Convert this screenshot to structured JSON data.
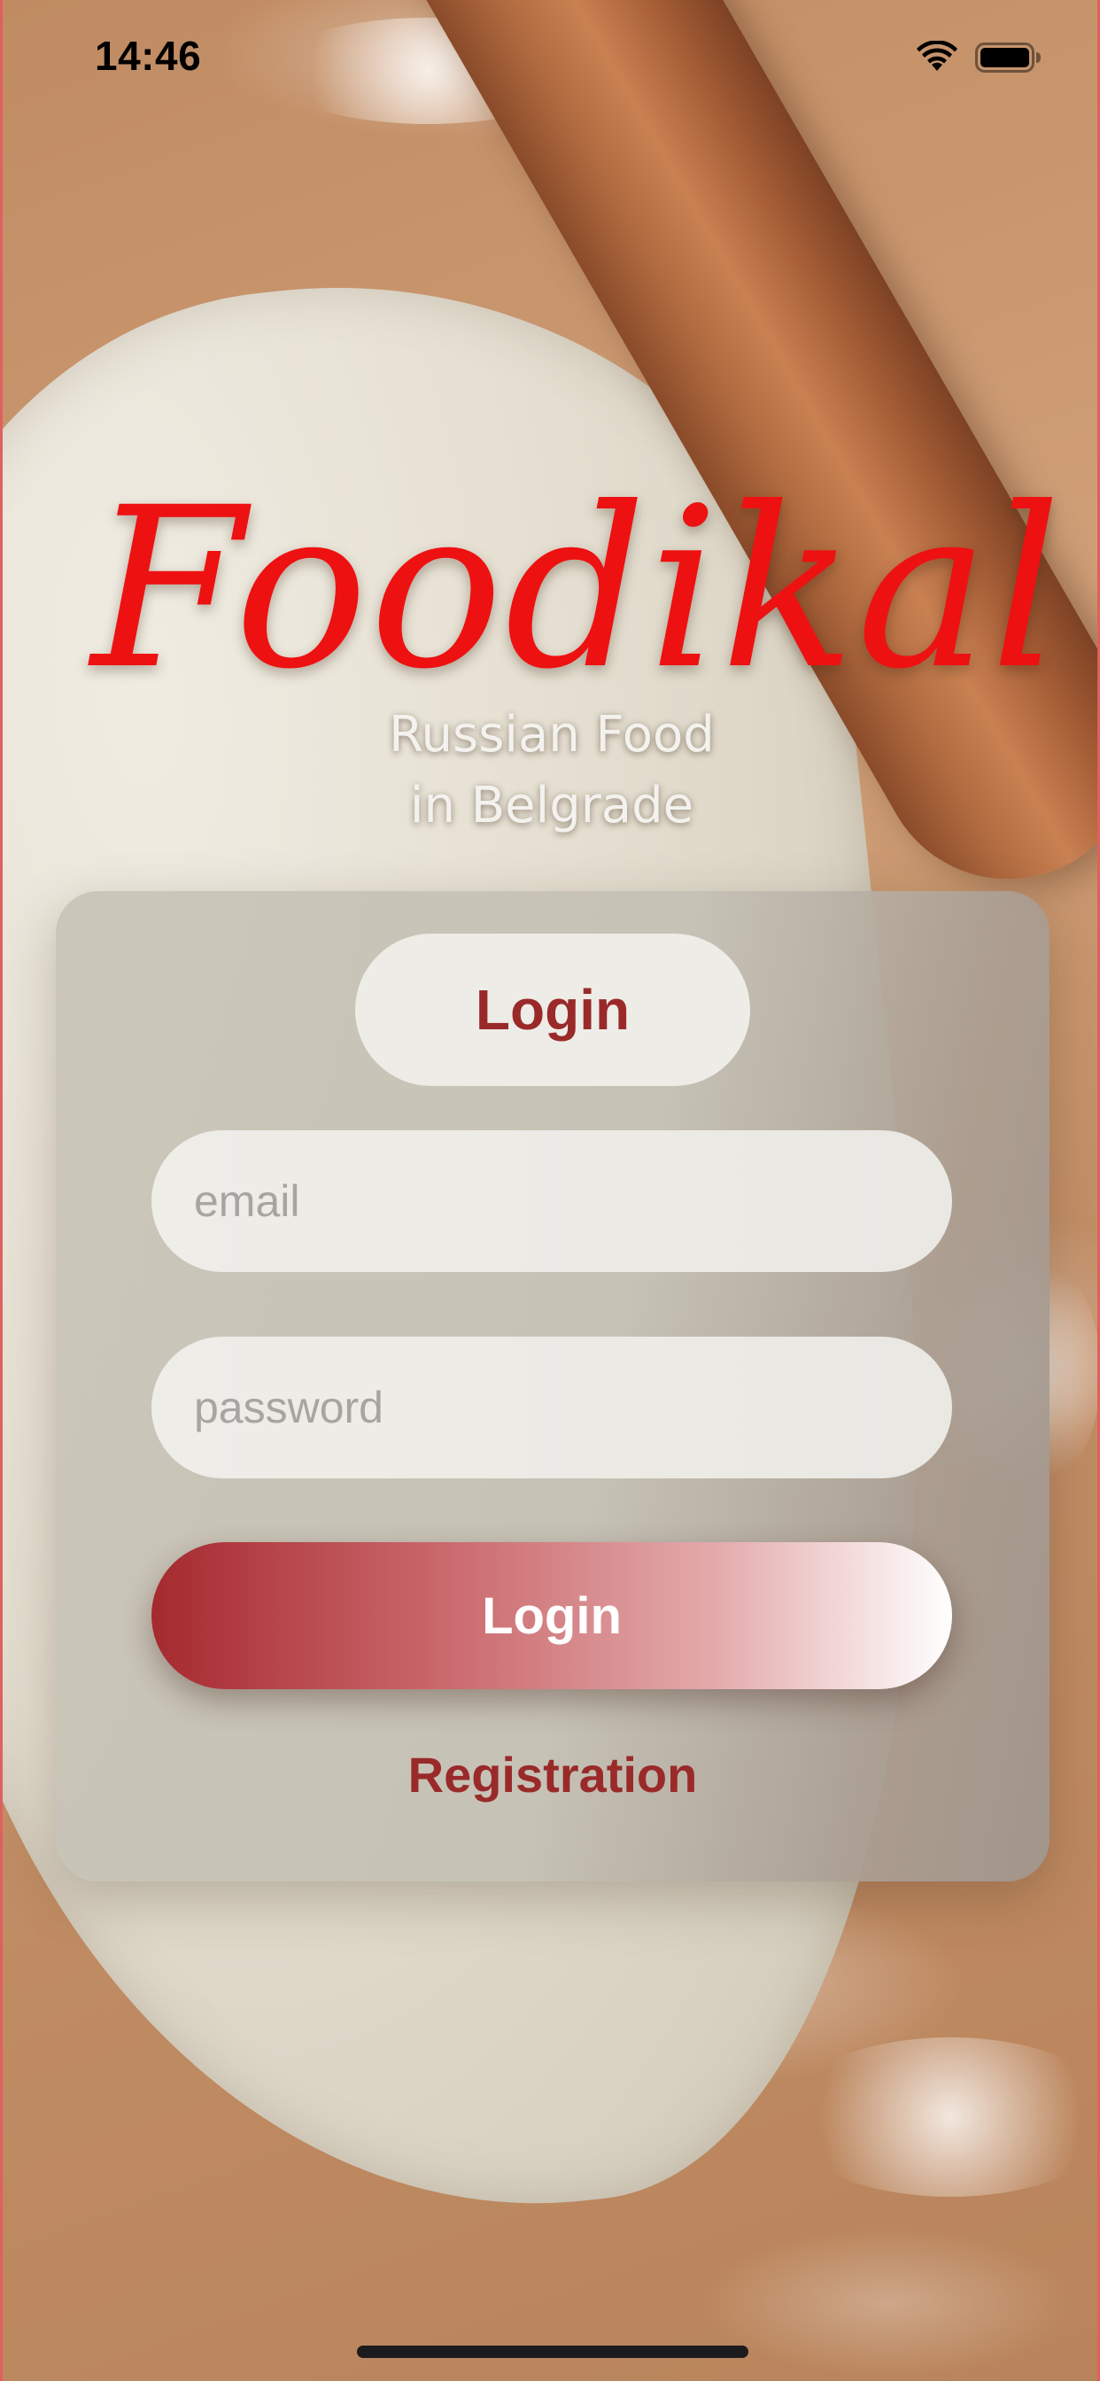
{
  "status_bar": {
    "time": "14:46"
  },
  "logo": {
    "title": "Foodikal",
    "subtitle_line1": "Russian Food",
    "subtitle_line2": "in Belgrade"
  },
  "card": {
    "tab_label": "Login",
    "email_placeholder": "email",
    "password_placeholder": "password",
    "login_button_label": "Login",
    "registration_label": "Registration"
  },
  "colors": {
    "brand_red": "#ee1111",
    "accent_dark_red": "#9a2a2a",
    "button_gradient_start": "#a52a2f",
    "button_gradient_end": "#ffffff"
  },
  "icons": [
    "wifi-icon",
    "battery-icon"
  ]
}
